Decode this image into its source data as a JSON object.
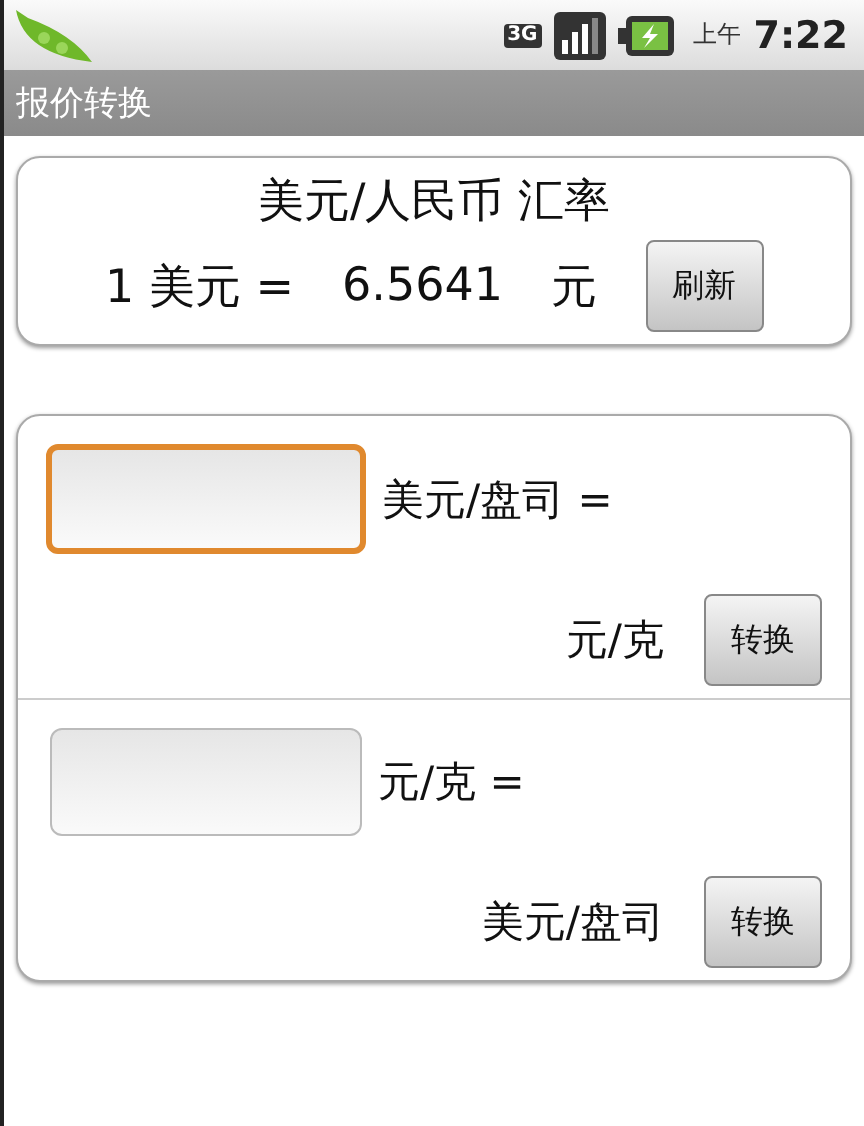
{
  "status_bar": {
    "network": "3G",
    "am_pm": "上午",
    "time": "7:22"
  },
  "title_bar": {
    "title": "报价转换"
  },
  "rate_card": {
    "heading": "美元/人民币 汇率",
    "amount": "1 美元 =",
    "rate": "6.5641",
    "unit": "元",
    "refresh_button": "刷新"
  },
  "converters": [
    {
      "focused": true,
      "input_unit": "美元/盘司 =",
      "output_unit": "元/克",
      "button": "转换"
    },
    {
      "focused": false,
      "input_unit": "元/克 =",
      "output_unit": "美元/盘司",
      "button": "转换"
    }
  ]
}
